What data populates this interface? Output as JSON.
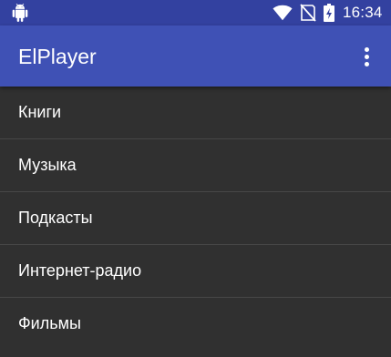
{
  "status_bar": {
    "time": "16:34",
    "icons": [
      "android-icon",
      "wifi-icon",
      "no-signal-icon",
      "battery-charging-icon"
    ],
    "background": "#3341a0"
  },
  "app_bar": {
    "title": "ElPlayer",
    "menu_icon": "more-vert-icon",
    "background": "#3f51b5"
  },
  "list": {
    "items": [
      {
        "label": "Книги"
      },
      {
        "label": "Музыка"
      },
      {
        "label": "Подкасты"
      },
      {
        "label": "Интернет-радио"
      },
      {
        "label": "Фильмы"
      }
    ],
    "background": "#303030",
    "divider": "#474747"
  }
}
